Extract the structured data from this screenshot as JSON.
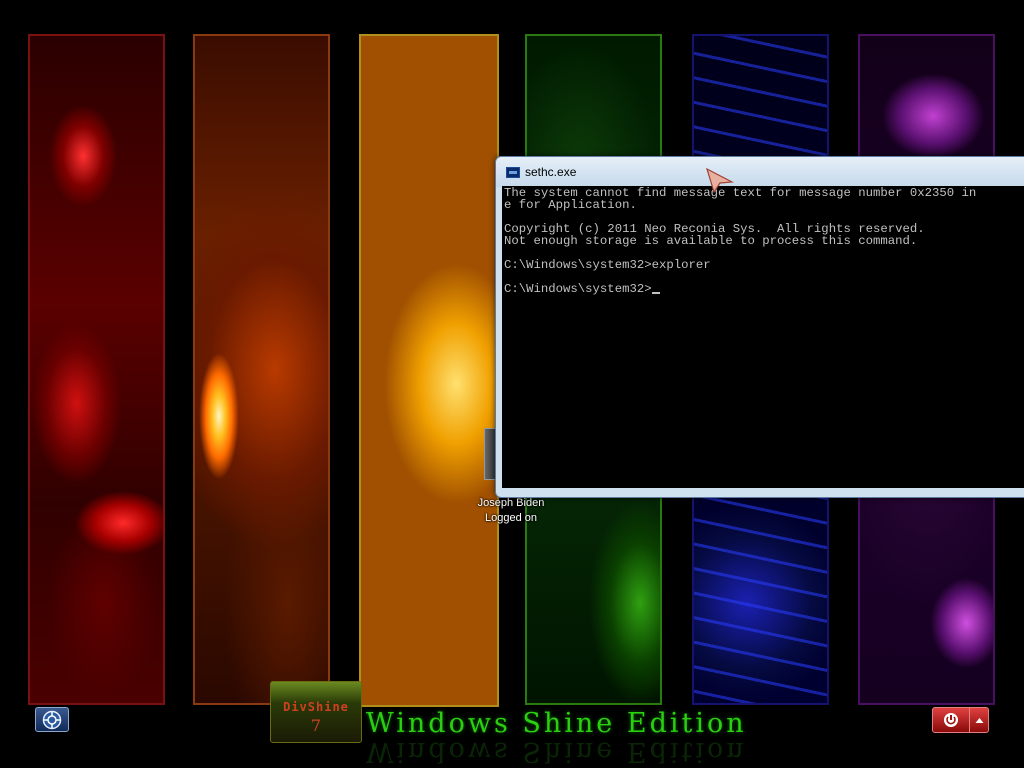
{
  "wallpaper": {
    "panels": [
      {
        "name": "red-panel",
        "color": "#c00000"
      },
      {
        "name": "orange-panel",
        "color": "#e05a00"
      },
      {
        "name": "yellow-panel",
        "color": "#f0b000"
      },
      {
        "name": "green-panel",
        "color": "#20a010"
      },
      {
        "name": "blue-panel",
        "color": "#2030e0"
      },
      {
        "name": "purple-panel",
        "color": "#a030c0"
      }
    ]
  },
  "user": {
    "name": "Joseph Biden",
    "status": "Logged on"
  },
  "console": {
    "title": "sethc.exe",
    "icon": "console-icon",
    "lines": [
      "The system cannot find message text for message number 0x2350 in",
      "e for Application.",
      "",
      "Copyright (c) 2011 Neo Reconia Sys.  All rights reserved.",
      "Not enough storage is available to process this command.",
      "",
      "C:\\Windows\\system32>explorer",
      "",
      "C:\\Windows\\system32>"
    ]
  },
  "bottom": {
    "ease_of_access_icon": "ease-of-access-icon",
    "logo_text": "DivShine",
    "logo_number": "7",
    "edition_text": "Windows Shine Edition",
    "power_icon": "power-icon",
    "power_menu_icon": "chevron-up-icon"
  },
  "colors": {
    "edition_green": "#2ad010",
    "console_bg": "#000000",
    "console_text": "#c0c0c0",
    "power_red": "#c02020"
  }
}
